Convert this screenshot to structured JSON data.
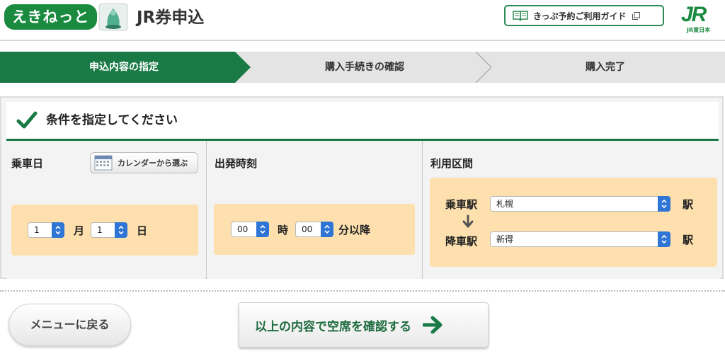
{
  "header": {
    "logo_text": "えきねっと",
    "app_title": "JR券申込",
    "guide_label": "きっぷ予約ご利用ガイド",
    "jr_logo": "JR",
    "jr_sub": "JR東日本"
  },
  "steps": [
    {
      "label": "申込内容の指定",
      "active": true
    },
    {
      "label": "購入手続きの確認",
      "active": false
    },
    {
      "label": "購入完了",
      "active": false
    }
  ],
  "panel": {
    "title": "条件を指定してください",
    "date_section": {
      "title": "乗車日",
      "calendar_button": "カレンダーから選ぶ",
      "month_value": "1",
      "month_unit": "月",
      "day_value": "1",
      "day_unit": "日"
    },
    "time_section": {
      "title": "出発時刻",
      "hour_value": "00",
      "hour_unit": "時",
      "minute_value": "00",
      "minute_unit": "分以降"
    },
    "route_section": {
      "title": "利用区間",
      "departure_label": "乗車駅",
      "departure_value": "札幌",
      "departure_unit": "駅",
      "arrival_label": "降車駅",
      "arrival_value": "新得",
      "arrival_unit": "駅"
    }
  },
  "footer": {
    "back_button": "メニューに戻る",
    "confirm_button": "以上の内容で空席を確認する"
  },
  "colors": {
    "brand_green": "#1a8a3f",
    "active_step": "#1a7a46",
    "input_box": "#fde0ae",
    "select_arrow": "#2e75d6"
  }
}
